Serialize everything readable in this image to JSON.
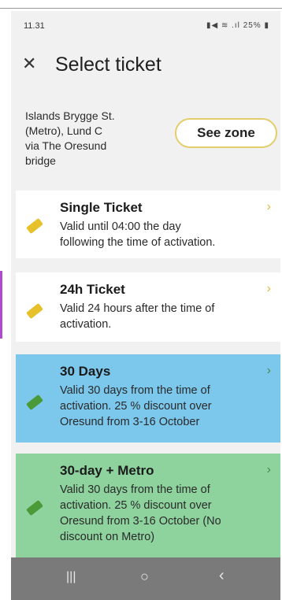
{
  "status": {
    "time": "11.31",
    "indicators": "25%"
  },
  "header": {
    "title": "Select ticket"
  },
  "route": {
    "lines": [
      "Islands Brygge St.",
      "(Metro), Lund C",
      "via The Oresund",
      "bridge"
    ]
  },
  "zone_button": {
    "label": "See zone"
  },
  "tickets": [
    {
      "name": "Single Ticket",
      "desc": [
        "Valid until 04:00 the day",
        "following the time of activation."
      ]
    },
    {
      "name": "24h Ticket",
      "desc": [
        "Valid 24 hours after the time of",
        "activation."
      ]
    },
    {
      "name": "30 Days",
      "desc": [
        "Valid 30 days from the time of",
        "activation. 25 % discount over",
        "Oresund from 3-16 October"
      ]
    },
    {
      "name": "30-day + Metro",
      "desc": [
        "Valid 30 days from the time of",
        "activation. 25 % discount over",
        "Oresund from 3-16 October (No",
        "discount on Metro)"
      ]
    }
  ],
  "icons": {
    "close": "close-icon",
    "ticket": "ticket-icon",
    "chevron": "chevron-right-icon"
  },
  "colors": {
    "white_card": "#ffffff",
    "blue_card": "#7cc7ec",
    "green_card": "#8ed39e",
    "accent": "#e6c12b",
    "zone_border": "#e3cc6a"
  }
}
